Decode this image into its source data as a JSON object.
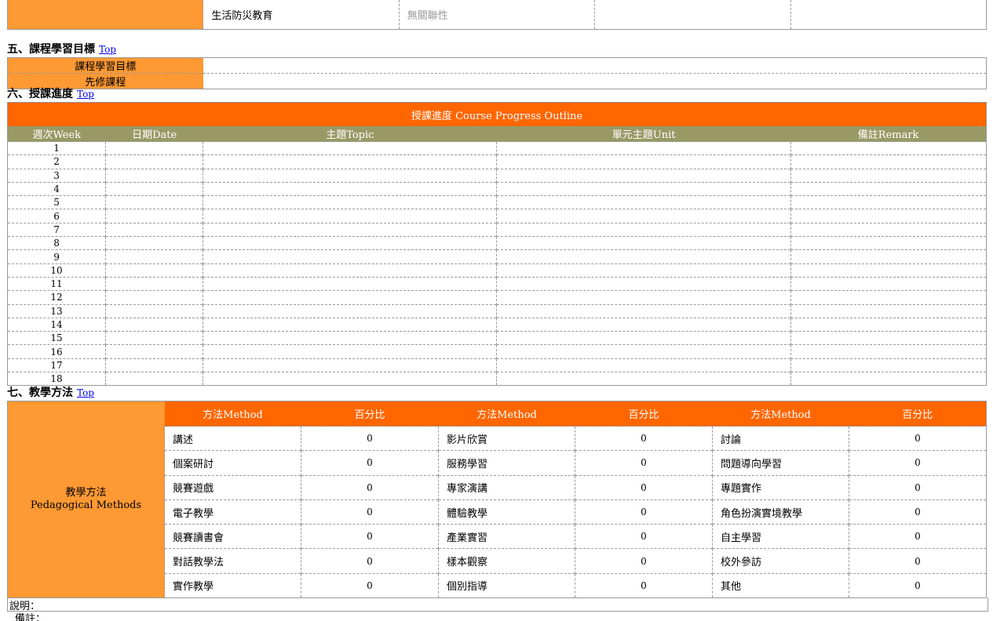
{
  "top_row": {
    "col2": "生活防災教育",
    "col3": "無關聯性"
  },
  "section5": {
    "heading": "五、課程學習目標",
    "top_link": "Top",
    "rows": [
      {
        "label": "課程學習目標"
      },
      {
        "label": "先修課程"
      }
    ]
  },
  "section6": {
    "heading": "六、授課進度",
    "top_link": "Top",
    "table_title": "授課進度 Course Progress Outline",
    "headers": [
      "週次Week",
      "日期Date",
      "主題Topic",
      "單元主題Unit",
      "備註Remark"
    ],
    "weeks": [
      "1",
      "2",
      "3",
      "4",
      "5",
      "6",
      "7",
      "8",
      "9",
      "10",
      "11",
      "12",
      "13",
      "14",
      "15",
      "16",
      "17",
      "18"
    ]
  },
  "section7": {
    "heading": "七、教學方法",
    "top_link": "Top",
    "side_label_zh": "教學方法",
    "side_label_en": "Pedagogical Methods",
    "headers": [
      "方法Method",
      "百分比",
      "方法Method",
      "百分比",
      "方法Method",
      "百分比"
    ],
    "rows": [
      [
        {
          "m": "講述",
          "p": "0"
        },
        {
          "m": "影片欣賞",
          "p": "0"
        },
        {
          "m": "討論",
          "p": "0"
        }
      ],
      [
        {
          "m": "個案研討",
          "p": "0"
        },
        {
          "m": "服務學習",
          "p": "0"
        },
        {
          "m": "問題導向學習",
          "p": "0"
        }
      ],
      [
        {
          "m": "競賽遊戲",
          "p": "0"
        },
        {
          "m": "專家演講",
          "p": "0"
        },
        {
          "m": "專題實作",
          "p": "0"
        }
      ],
      [
        {
          "m": "電子教學",
          "p": "0"
        },
        {
          "m": "體驗教學",
          "p": "0"
        },
        {
          "m": "角色扮演實境教學",
          "p": "0"
        }
      ],
      [
        {
          "m": "競賽讀書會",
          "p": "0"
        },
        {
          "m": "產業實習",
          "p": "0"
        },
        {
          "m": "自主學習",
          "p": "0"
        }
      ],
      [
        {
          "m": "對話教學法",
          "p": "0"
        },
        {
          "m": "樣本觀察",
          "p": "0"
        },
        {
          "m": "校外參訪",
          "p": "0"
        }
      ],
      [
        {
          "m": "實作教學",
          "p": "0"
        },
        {
          "m": "個別指導",
          "p": "0"
        },
        {
          "m": "其他",
          "p": "0"
        }
      ]
    ],
    "note_label": "說明：",
    "remark_label": "備註："
  },
  "colors": {
    "orange_light": "#FF9933",
    "orange_dark": "#FF6600",
    "olive": "#999966"
  }
}
